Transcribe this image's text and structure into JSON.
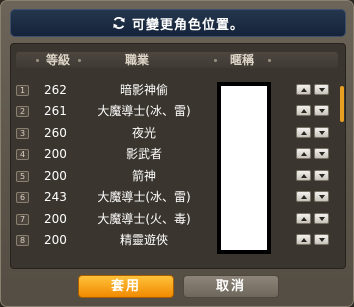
{
  "title": "可變更角色位置。",
  "headers": {
    "level": "等級",
    "job": "職業",
    "nickname": "暱稱"
  },
  "rows": [
    {
      "num": "1",
      "level": "262",
      "job": "暗影神偷"
    },
    {
      "num": "2",
      "level": "261",
      "job": "大魔導士(冰、雷)"
    },
    {
      "num": "3",
      "level": "260",
      "job": "夜光"
    },
    {
      "num": "4",
      "level": "200",
      "job": "影武者"
    },
    {
      "num": "5",
      "level": "200",
      "job": "箭神"
    },
    {
      "num": "6",
      "level": "243",
      "job": "大魔導士(冰、雷)"
    },
    {
      "num": "7",
      "level": "200",
      "job": "大魔導士(火、毒)"
    },
    {
      "num": "8",
      "level": "200",
      "job": "精靈遊俠"
    }
  ],
  "buttons": {
    "apply": "套用",
    "cancel": "取消"
  },
  "icons": {
    "title": "refresh-icon",
    "move_up": "arrow-up-icon",
    "move_down": "arrow-down-icon"
  },
  "colors": {
    "accent": "#f08a00",
    "title_bg": "#15233a",
    "scroll": "#e8a020"
  }
}
